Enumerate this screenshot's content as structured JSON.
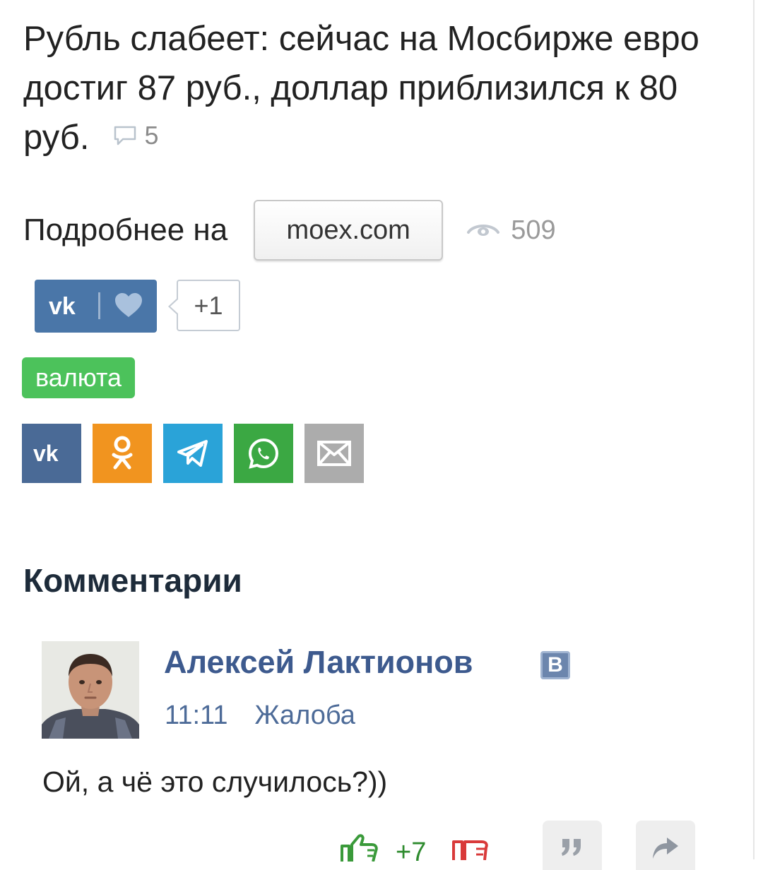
{
  "article": {
    "title": "Рубль слабеет: сейчас на Мосбирже евро достиг 87 руб., доллар приблизился к 80 руб.",
    "comment_count": "5",
    "source_label": "Подробнее на",
    "source_button": "moex.com",
    "views": "509"
  },
  "vk_like": {
    "count": "+1"
  },
  "tags": [
    {
      "label": "валюта",
      "color": "#4cc25b"
    }
  ],
  "share_buttons": [
    {
      "name": "vk",
      "color": "#4a6a96",
      "icon": "vk-icon"
    },
    {
      "name": "odnoklassniki",
      "color": "#f1941f",
      "icon": "odnoklassniki-icon"
    },
    {
      "name": "telegram",
      "color": "#2aa3d8",
      "icon": "telegram-icon"
    },
    {
      "name": "whatsapp",
      "color": "#3ba843",
      "icon": "whatsapp-icon"
    },
    {
      "name": "email",
      "color": "#acacac",
      "icon": "mail-icon"
    }
  ],
  "comments": {
    "heading": "Комментарии",
    "items": [
      {
        "author": "Алексей Лактионов",
        "badge": "В",
        "time": "11:11",
        "report_label": "Жалоба",
        "text": "Ой, а чё это случилось?))",
        "rating": "+7"
      }
    ]
  },
  "colors": {
    "author_link": "#3d5a8e",
    "meta_link": "#4d6b98",
    "rating_positive": "#2e8b2e",
    "rating_negative": "#d93a3a",
    "vk_blue": "#4a76a8"
  }
}
